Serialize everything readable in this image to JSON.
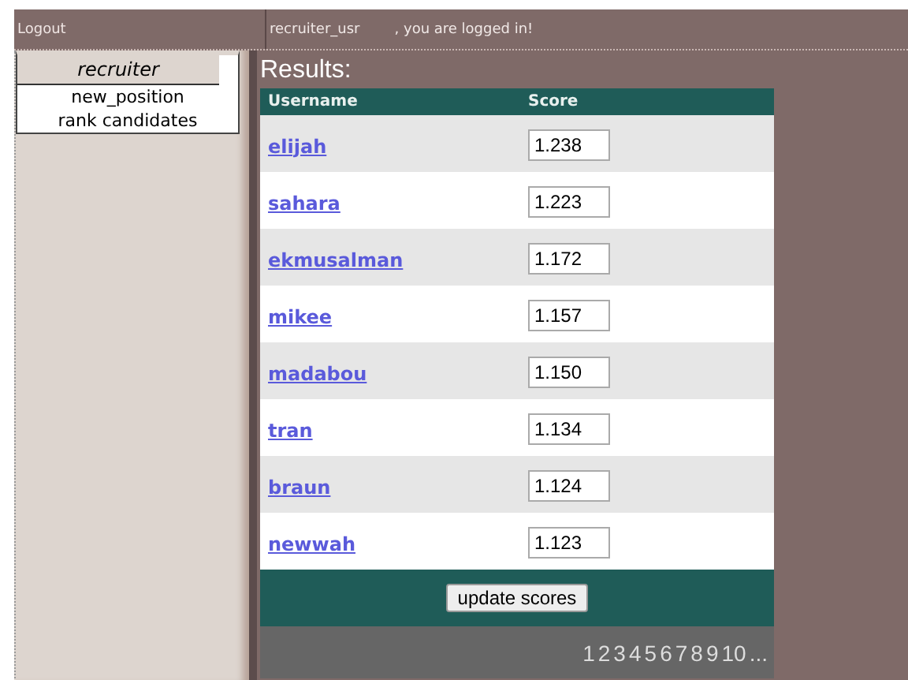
{
  "top_bar": {
    "logout": "Logout",
    "username": "recruiter_usr",
    "message": ", you are logged in!"
  },
  "sidebar": {
    "title": "recruiter",
    "items": [
      {
        "label": "new_position"
      },
      {
        "label": "rank candidates"
      }
    ]
  },
  "results": {
    "title": "Results:",
    "columns": [
      "Username",
      "Score"
    ],
    "rows": [
      {
        "username": "elijah",
        "score": "1.238"
      },
      {
        "username": "sahara",
        "score": "1.223"
      },
      {
        "username": "ekmusalman",
        "score": "1.172"
      },
      {
        "username": "mikee",
        "score": "1.157"
      },
      {
        "username": "madabou",
        "score": "1.150"
      },
      {
        "username": "tran",
        "score": "1.134"
      },
      {
        "username": "braun",
        "score": "1.124"
      },
      {
        "username": "newwah",
        "score": "1.123"
      }
    ],
    "button": "update scores",
    "pages": [
      "1",
      "2",
      "3",
      "4",
      "5",
      "6",
      "7",
      "8",
      "9",
      "10",
      "..."
    ]
  }
}
